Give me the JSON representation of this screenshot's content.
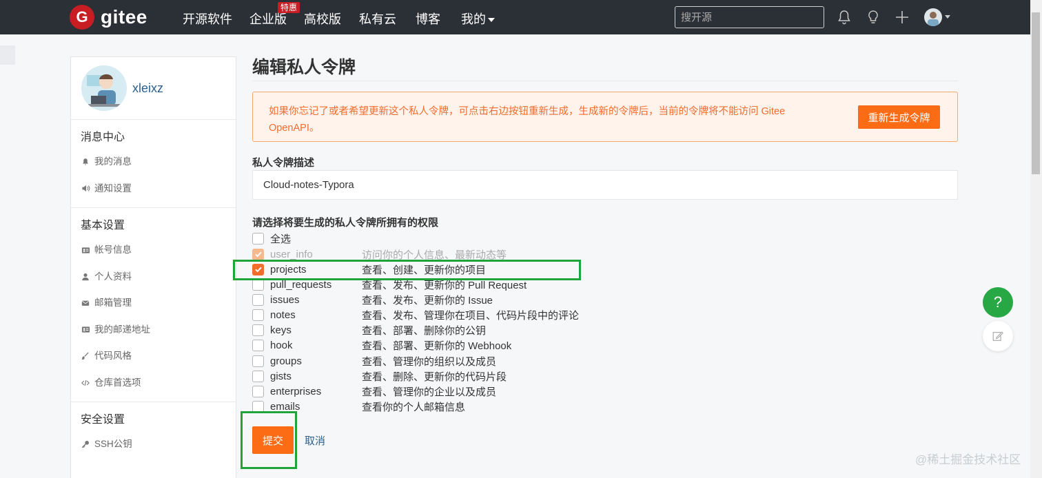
{
  "nav": {
    "logo_mark": "G",
    "logo_text": "gitee",
    "items": [
      "开源软件",
      "企业版",
      "高校版",
      "私有云",
      "博客",
      "我的"
    ],
    "badge": "特惠",
    "search_placeholder": "搜开源"
  },
  "sidebar": {
    "username": "xleixz",
    "sections": [
      {
        "title": "消息中心",
        "items": [
          {
            "label": "我的消息",
            "icon": "bell-icon"
          },
          {
            "label": "通知设置",
            "icon": "speaker-icon"
          }
        ]
      },
      {
        "title": "基本设置",
        "items": [
          {
            "label": "帐号信息",
            "icon": "id-card-icon"
          },
          {
            "label": "个人资料",
            "icon": "person-icon"
          },
          {
            "label": "邮箱管理",
            "icon": "envelope-icon"
          },
          {
            "label": "我的邮递地址",
            "icon": "address-card-icon"
          },
          {
            "label": "代码风格",
            "icon": "brush-icon"
          },
          {
            "label": "仓库首选项",
            "icon": "code-icon"
          }
        ]
      },
      {
        "title": "安全设置",
        "items": [
          {
            "label": "SSH公钥",
            "icon": "key-icon"
          }
        ]
      }
    ]
  },
  "main": {
    "title": "编辑私人令牌",
    "alert_text": "如果你忘记了或者希望更新这个私人令牌，可点击右边按钮重新生成，生成新的令牌后，当前的令牌将不能访问 Gitee OpenAPI。",
    "regen_button": "重新生成令牌",
    "desc_label": "私人令牌描述",
    "desc_value": "Cloud-notes-Typora",
    "perm_label": "请选择将要生成的私人令牌所拥有的权限",
    "select_all": "全选",
    "permissions": [
      {
        "name": "user_info",
        "desc": "访问你的个人信息、最新动态等",
        "checked": true,
        "disabled": true
      },
      {
        "name": "projects",
        "desc": "查看、创建、更新你的项目",
        "checked": true,
        "disabled": false
      },
      {
        "name": "pull_requests",
        "desc": "查看、发布、更新你的 Pull Request",
        "checked": false,
        "disabled": false
      },
      {
        "name": "issues",
        "desc": "查看、发布、更新你的 Issue",
        "checked": false,
        "disabled": false
      },
      {
        "name": "notes",
        "desc": "查看、发布、管理你在项目、代码片段中的评论",
        "checked": false,
        "disabled": false
      },
      {
        "name": "keys",
        "desc": "查看、部署、删除你的公钥",
        "checked": false,
        "disabled": false
      },
      {
        "name": "hook",
        "desc": "查看、部署、更新你的 Webhook",
        "checked": false,
        "disabled": false
      },
      {
        "name": "groups",
        "desc": "查看、管理你的组织以及成员",
        "checked": false,
        "disabled": false
      },
      {
        "name": "gists",
        "desc": "查看、删除、更新你的代码片段",
        "checked": false,
        "disabled": false
      },
      {
        "name": "enterprises",
        "desc": "查看、管理你的企业以及成员",
        "checked": false,
        "disabled": false
      },
      {
        "name": "emails",
        "desc": "查看你的个人邮箱信息",
        "checked": false,
        "disabled": false
      }
    ],
    "submit_button": "提交",
    "cancel_link": "取消"
  },
  "float": {
    "help": "?"
  },
  "watermark": "@稀土掘金技术社区",
  "colors": {
    "brand": "#c71d23",
    "accent": "#fb6c14",
    "highlight": "#1fa33b",
    "navbar": "#2b2f36"
  }
}
